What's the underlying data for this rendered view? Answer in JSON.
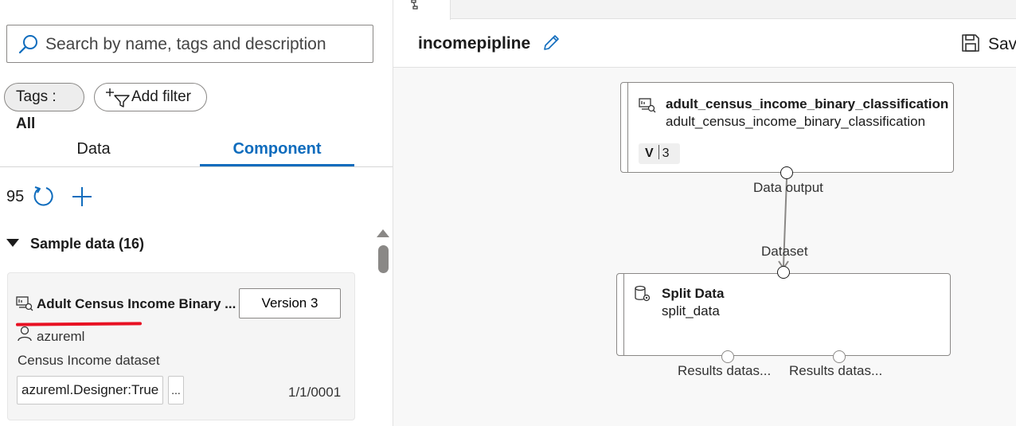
{
  "search": {
    "placeholder": "Search by name, tags and description"
  },
  "filters": {
    "tags_label": "Tags : ",
    "tags_value": "All",
    "add_filter_label": "Add filter"
  },
  "tabs": [
    {
      "label": "Data",
      "active": false
    },
    {
      "label": "Component",
      "active": true
    }
  ],
  "list": {
    "count": "95",
    "section_label": "Sample data (16)",
    "card": {
      "title": "Adult Census Income Binary ...",
      "version_label": "Version 3",
      "user": "azureml",
      "description": "Census Income dataset",
      "tag": "azureml.Designer:True",
      "more": "...",
      "date": "1/1/0001"
    }
  },
  "pipeline": {
    "title": "incomepipline",
    "save_label": "Save",
    "nodes": [
      {
        "title": "adult_census_income_binary_classification",
        "subtitle": "adult_census_income_binary_classification",
        "version_letter": "V",
        "version_number": "3",
        "output_label": "Data output"
      },
      {
        "title": "Split Data",
        "subtitle": "split_data",
        "input_label": "Dataset",
        "output_labels": [
          "Results datas...",
          "Results datas..."
        ]
      }
    ]
  },
  "colors": {
    "accent": "#0f6cbd",
    "annotation_underline": "#e81123"
  }
}
